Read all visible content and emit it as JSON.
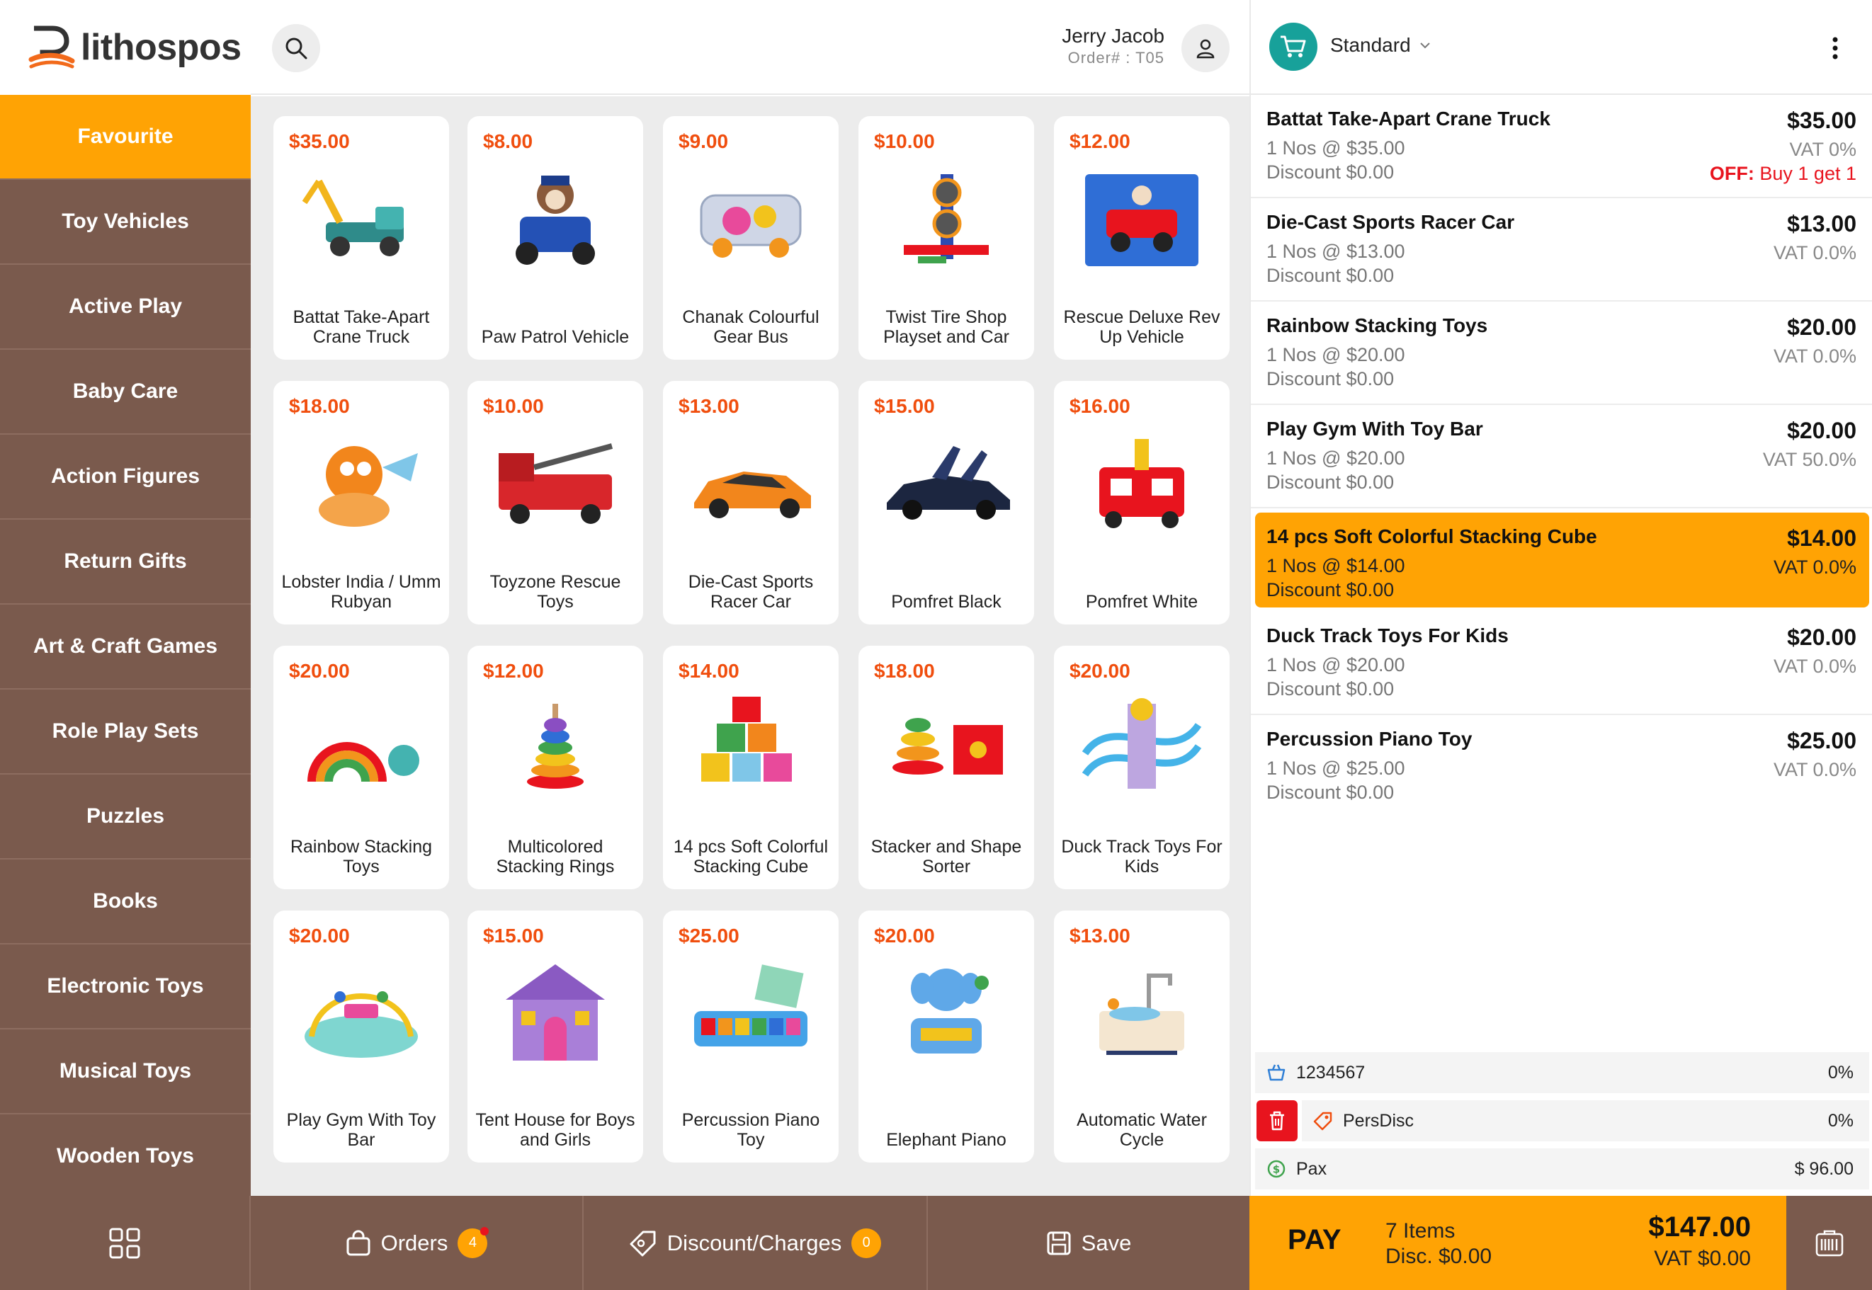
{
  "brand": {
    "name": "lithospos"
  },
  "header": {
    "user_name": "Jerry Jacob",
    "order_label": "Order# : T05",
    "search_icon": "search-icon",
    "user_icon": "user-icon"
  },
  "categories": [
    {
      "label": "Favourite",
      "active": true
    },
    {
      "label": "Toy Vehicles"
    },
    {
      "label": "Active Play"
    },
    {
      "label": "Baby Care"
    },
    {
      "label": "Action Figures"
    },
    {
      "label": "Return Gifts"
    },
    {
      "label": "Art & Craft Games"
    },
    {
      "label": "Role Play Sets"
    },
    {
      "label": "Puzzles"
    },
    {
      "label": "Books"
    },
    {
      "label": "Electronic Toys"
    },
    {
      "label": "Musical Toys"
    },
    {
      "label": "Wooden Toys"
    }
  ],
  "products": [
    {
      "price": "$35.00",
      "name": "Battat Take-Apart Crane Truck"
    },
    {
      "price": "$8.00",
      "name": "Paw Patrol Vehicle"
    },
    {
      "price": "$9.00",
      "name": "Chanak Colourful Gear Bus"
    },
    {
      "price": "$10.00",
      "name": "Twist Tire Shop Playset and Car"
    },
    {
      "price": "$12.00",
      "name": "Rescue Deluxe Rev Up Vehicle"
    },
    {
      "price": "$18.00",
      "name": "Lobster India / Umm Rubyan"
    },
    {
      "price": "$10.00",
      "name": "Toyzone Rescue Toys"
    },
    {
      "price": "$13.00",
      "name": "Die-Cast Sports Racer Car"
    },
    {
      "price": "$15.00",
      "name": "Pomfret Black"
    },
    {
      "price": "$16.00",
      "name": "Pomfret White"
    },
    {
      "price": "$20.00",
      "name": "Rainbow Stacking Toys"
    },
    {
      "price": "$12.00",
      "name": "Multicolored Stacking Rings"
    },
    {
      "price": "$14.00",
      "name": "14 pcs Soft Colorful Stacking Cube"
    },
    {
      "price": "$18.00",
      "name": "Stacker and Shape Sorter"
    },
    {
      "price": "$20.00",
      "name": "Duck Track Toys For Kids"
    },
    {
      "price": "$20.00",
      "name": "Play Gym With Toy Bar"
    },
    {
      "price": "$15.00",
      "name": "Tent House for Boys and Girls"
    },
    {
      "price": "$25.00",
      "name": "Percussion Piano Toy"
    },
    {
      "price": "$20.00",
      "name": "Elephant Piano"
    },
    {
      "price": "$13.00",
      "name": "Automatic Water Cycle"
    }
  ],
  "cart": {
    "price_list": "Standard",
    "lines": [
      {
        "name": "Battat Take-Apart Crane Truck",
        "qty": "1 Nos @ $35.00",
        "discount": "Discount $0.00",
        "amount": "$35.00",
        "vat": "VAT 0%",
        "offer_label": "OFF:",
        "offer": "Buy 1 get 1"
      },
      {
        "name": "Die-Cast Sports Racer Car",
        "qty": "1 Nos @ $13.00",
        "discount": "Discount $0.00",
        "amount": "$13.00",
        "vat": "VAT 0.0%"
      },
      {
        "name": "Rainbow Stacking Toys",
        "qty": "1 Nos @ $20.00",
        "discount": "Discount $0.00",
        "amount": "$20.00",
        "vat": "VAT 0.0%"
      },
      {
        "name": "Play Gym With Toy Bar",
        "qty": "1 Nos @ $20.00",
        "discount": "Discount $0.00",
        "amount": "$20.00",
        "vat": "VAT 50.0%"
      },
      {
        "name": "14 pcs Soft Colorful Stacking Cube",
        "qty": "1 Nos @ $14.00",
        "discount": "Discount $0.00",
        "amount": "$14.00",
        "vat": "VAT 0.0%",
        "selected": true
      },
      {
        "name": "Duck Track Toys For Kids",
        "qty": "1 Nos @ $20.00",
        "discount": "Discount $0.00",
        "amount": "$20.00",
        "vat": "VAT 0.0%"
      },
      {
        "name": "Percussion Piano Toy",
        "qty": "1 Nos @ $25.00",
        "discount": "Discount $0.00",
        "amount": "$25.00",
        "vat": "VAT 0.0%"
      }
    ],
    "summary": [
      {
        "label": "1234567",
        "value": "0%",
        "icon": "basket-icon"
      },
      {
        "label": "PersDisc",
        "value": "0%",
        "icon": "tag-icon"
      },
      {
        "label": "Pax",
        "value": "$ 96.00",
        "icon": "dollar-icon"
      }
    ]
  },
  "footer": {
    "orders_label": "Orders",
    "orders_count": "4",
    "discount_label": "Discount/Charges",
    "discount_count": "0",
    "save_label": "Save"
  },
  "pay": {
    "label": "PAY",
    "items": "7 Items",
    "disc": "Disc. $0.00",
    "total": "$147.00",
    "vat": "VAT $0.00"
  },
  "colors": {
    "accent": "#ffa304",
    "sidebar": "#7a5a4d",
    "price": "#f04e0e",
    "offer": "#e8141e",
    "teal": "#17a19a"
  }
}
